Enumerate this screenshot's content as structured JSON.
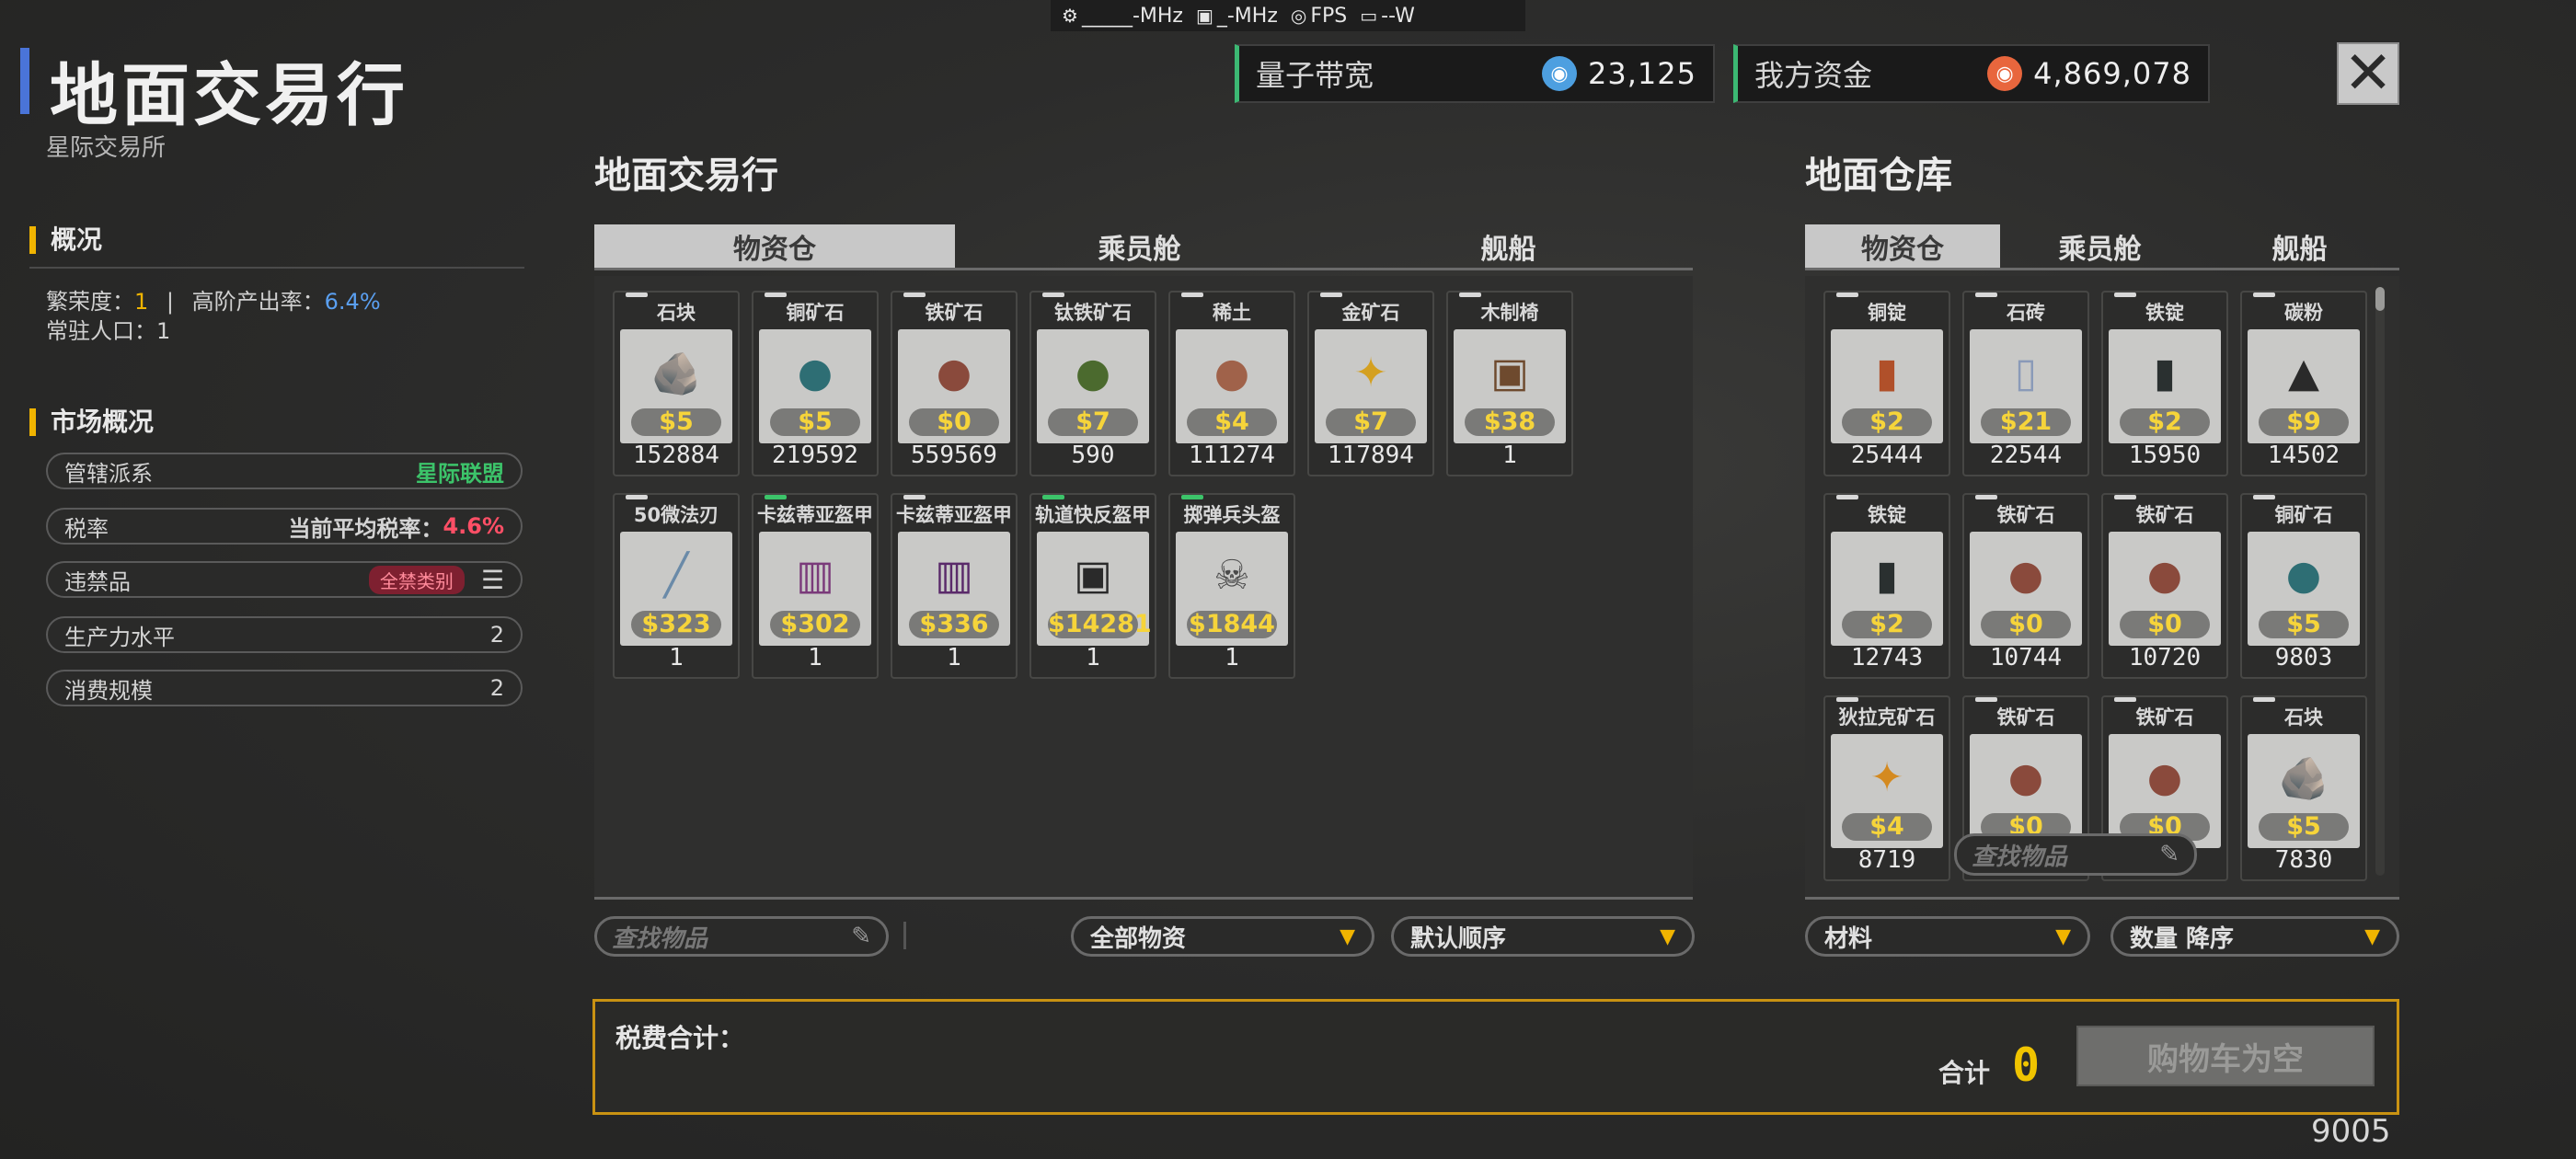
{
  "statusbar": {
    "cpu": "_____-MHz",
    "gpu": "_-MHz",
    "fps": "FPS",
    "power": "--W"
  },
  "header": {
    "title": "地面交易行",
    "subtitle": "星际交易所"
  },
  "currency": [
    {
      "label": "量子带宽",
      "value": "23,125",
      "icon": "quantum-coin-icon",
      "color": "#4d9fe0"
    },
    {
      "label": "我方资金",
      "value": "4,869,078",
      "icon": "money-coin-icon",
      "color": "#e8663d"
    }
  ],
  "close_label": "✕",
  "overview": {
    "heading": "概况",
    "prosperity_label": "繁荣度：",
    "prosperity_value": "1",
    "sep": "|",
    "rate_label": "高阶产出率：",
    "rate_value": "6.4%",
    "population_label": "常驻人口：",
    "population_value": "1"
  },
  "market": {
    "heading": "市场概况",
    "rows": [
      {
        "label": "管辖派系",
        "value": "星际联盟"
      },
      {
        "label": "税率",
        "sub": "当前平均税率：",
        "value": "4.6%"
      },
      {
        "label": "违禁品",
        "value": "全禁类别"
      },
      {
        "label": "生产力水平",
        "value": "2"
      },
      {
        "label": "消费规模",
        "value": "2"
      }
    ]
  },
  "trade": {
    "title": "地面交易行",
    "tabs": [
      "物资仓",
      "乘员舱",
      "舰船"
    ],
    "items": [
      {
        "name": "石块",
        "price": "$5",
        "qty": "152884",
        "glyph": "🪨",
        "color": "#9aa0a8",
        "marker": "white"
      },
      {
        "name": "铜矿石",
        "price": "$5",
        "qty": "219592",
        "glyph": "●",
        "color": "#2e6e74",
        "marker": "white"
      },
      {
        "name": "铁矿石",
        "price": "$0",
        "qty": "559569",
        "glyph": "●",
        "color": "#8a4a3c",
        "marker": "white"
      },
      {
        "name": "钛铁矿石",
        "price": "$7",
        "qty": "590",
        "glyph": "●",
        "color": "#4b6a2e",
        "marker": "white"
      },
      {
        "name": "稀土",
        "price": "$4",
        "qty": "111274",
        "glyph": "●",
        "color": "#a0624a",
        "marker": "white"
      },
      {
        "name": "金矿石",
        "price": "$7",
        "qty": "117894",
        "glyph": "✦",
        "color": "#d4a020",
        "marker": "white"
      },
      {
        "name": "木制椅",
        "price": "$38",
        "qty": "1",
        "glyph": "▣",
        "color": "#6e4a2e",
        "marker": "white"
      },
      {
        "name": "50微法刃",
        "price": "$323",
        "qty": "1",
        "glyph": "╱",
        "color": "#6a8aa8",
        "marker": "white"
      },
      {
        "name": "卡兹蒂亚盔甲",
        "price": "$302",
        "qty": "1",
        "glyph": "▥",
        "color": "#7a3a7a",
        "marker": "green"
      },
      {
        "name": "卡兹蒂亚盔甲",
        "price": "$336",
        "qty": "1",
        "glyph": "▥",
        "color": "#5a2a6a",
        "marker": "white"
      },
      {
        "name": "轨道快反盔甲",
        "price": "$14281",
        "qty": "1",
        "glyph": "▣",
        "color": "#2a2a2a",
        "marker": "green"
      },
      {
        "name": "掷弹兵头盔",
        "price": "$1844",
        "qty": "1",
        "glyph": "☠",
        "color": "#4a4a4a",
        "marker": "green"
      }
    ],
    "search_placeholder": "查找物品",
    "filter": "全部物资",
    "sort": "默认顺序"
  },
  "warehouse": {
    "title": "地面仓库",
    "tabs": [
      "物资仓",
      "乘员舱",
      "舰船"
    ],
    "items": [
      {
        "name": "铜锭",
        "price": "$2",
        "qty": "25444",
        "glyph": "▮",
        "color": "#b0502a",
        "marker": "white"
      },
      {
        "name": "石砖",
        "price": "$21",
        "qty": "22544",
        "glyph": "▯",
        "color": "#8a9ab8",
        "marker": "white"
      },
      {
        "name": "铁锭",
        "price": "$2",
        "qty": "15950",
        "glyph": "▮",
        "color": "#2a3030",
        "marker": "white"
      },
      {
        "name": "碳粉",
        "price": "$9",
        "qty": "14502",
        "glyph": "▲",
        "color": "#2a2a2a",
        "marker": "white"
      },
      {
        "name": "铁锭",
        "price": "$2",
        "qty": "12743",
        "glyph": "▮",
        "color": "#2a3030",
        "marker": "white"
      },
      {
        "name": "铁矿石",
        "price": "$0",
        "qty": "10744",
        "glyph": "●",
        "color": "#8a4a3c",
        "marker": "white"
      },
      {
        "name": "铁矿石",
        "price": "$0",
        "qty": "10720",
        "glyph": "●",
        "color": "#8a4a3c",
        "marker": "white"
      },
      {
        "name": "铜矿石",
        "price": "$5",
        "qty": "9803",
        "glyph": "●",
        "color": "#2e6e74",
        "marker": "white"
      },
      {
        "name": "狄拉克矿石",
        "price": "$4",
        "qty": "8719",
        "glyph": "✦",
        "color": "#d48a20",
        "marker": "white"
      },
      {
        "name": "铁矿石",
        "price": "$0",
        "qty": "",
        "glyph": "●",
        "color": "#8a4a3c",
        "marker": "white"
      },
      {
        "name": "铁矿石",
        "price": "$0",
        "qty": "",
        "glyph": "●",
        "color": "#8a4a3c",
        "marker": "white"
      },
      {
        "name": "石块",
        "price": "$5",
        "qty": "7830",
        "glyph": "🪨",
        "color": "#9aa0a8",
        "marker": "white"
      }
    ],
    "search_placeholder": "查找物品",
    "filter": "材料",
    "sort": "数量 降序"
  },
  "cart": {
    "tax_label": "税费合计：",
    "total_label": "合计",
    "total_value": "0",
    "button": "购物车为空"
  },
  "footer_number": "9005"
}
